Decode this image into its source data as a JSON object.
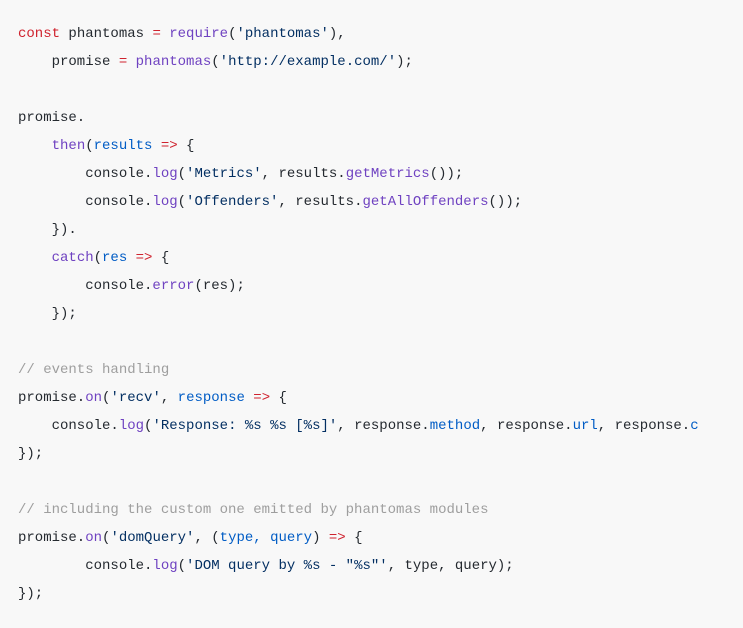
{
  "code": {
    "l1_kw": "const",
    "l1_v1": " phantomas ",
    "l1_eq": "=",
    "l1_sp": " ",
    "l1_fn": "require",
    "l1_p1": "(",
    "l1_s1": "'phantomas'",
    "l1_p2": "),",
    "l2_pad": "    promise ",
    "l2_eq": "=",
    "l2_sp": " ",
    "l2_fn": "phantomas",
    "l2_p1": "(",
    "l2_s1": "'http://example.com/'",
    "l2_p2": ");",
    "l4": "promise.",
    "l5_pad": "    ",
    "l5_fn": "then",
    "l5_p1": "(",
    "l5_arg": "results ",
    "l5_arrow": "=>",
    "l5_p2": " {",
    "l6_pad": "        console.",
    "l6_fn": "log",
    "l6_p1": "(",
    "l6_s1": "'Metrics'",
    "l6_c": ", results.",
    "l6_m": "getMetrics",
    "l6_p2": "());",
    "l7_pad": "        console.",
    "l7_fn": "log",
    "l7_p1": "(",
    "l7_s1": "'Offenders'",
    "l7_c": ", results.",
    "l7_m": "getAllOffenders",
    "l7_p2": "());",
    "l8": "    }).",
    "l9_pad": "    ",
    "l9_fn": "catch",
    "l9_p1": "(",
    "l9_arg": "res ",
    "l9_arrow": "=>",
    "l9_p2": " {",
    "l10_pad": "        console.",
    "l10_fn": "error",
    "l10_p1": "(res);",
    "l11": "    });",
    "l13": "// events handling",
    "l14_a": "promise.",
    "l14_fn": "on",
    "l14_p1": "(",
    "l14_s1": "'recv'",
    "l14_c": ", ",
    "l14_arg": "response ",
    "l14_arrow": "=>",
    "l14_p2": " {",
    "l15_pad": "    console.",
    "l15_fn": "log",
    "l15_p1": "(",
    "l15_s1": "'Response: %s %s [%s]'",
    "l15_c1": ", response.",
    "l15_m1": "method",
    "l15_c2": ", response.",
    "l15_m2": "url",
    "l15_c3": ", response.",
    "l15_m3": "c",
    "l16": "});",
    "l18": "// including the custom one emitted by phantomas modules",
    "l19_a": "promise.",
    "l19_fn": "on",
    "l19_p1": "(",
    "l19_s1": "'domQuery'",
    "l19_c": ", (",
    "l19_arg": "type, query",
    "l19_p2": ") ",
    "l19_arrow": "=>",
    "l19_p3": " {",
    "l20_pad": "        console.",
    "l20_fn": "log",
    "l20_p1": "(",
    "l20_s1": "'DOM query by %s - \"%s\"'",
    "l20_c": ", type, query);",
    "l21": "});"
  }
}
